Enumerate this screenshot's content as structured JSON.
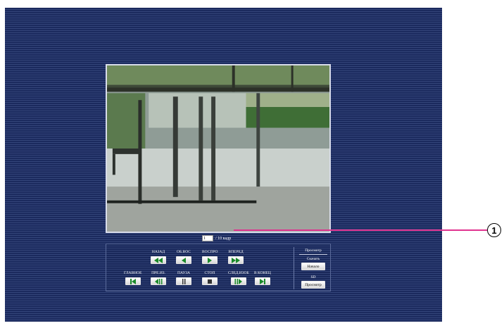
{
  "frame": {
    "current_value": "1",
    "total_text": "/ 10 кадр"
  },
  "controls": {
    "row1": [
      {
        "label": "НАЗАД",
        "icon": "fast-rewind-icon"
      },
      {
        "label": "ОБ.ВОС",
        "icon": "reverse-play-icon"
      },
      {
        "label": "ВОСПРО",
        "icon": "play-icon"
      },
      {
        "label": "ВПЕРЕД",
        "icon": "fast-forward-icon"
      }
    ],
    "row2": [
      {
        "label": "ГЛАВНОЕ",
        "icon": "skip-to-start-icon"
      },
      {
        "label": "ПРЕ.ИЗ.",
        "icon": "previous-frame-icon"
      },
      {
        "label": "ПАУЗА",
        "icon": "pause-icon"
      },
      {
        "label": "СТОП",
        "icon": "stop-icon"
      },
      {
        "label": "СЛЕД.ИЗОБ",
        "icon": "next-frame-icon"
      },
      {
        "label": "В КОНЕЦ",
        "icon": "skip-to-end-icon"
      }
    ]
  },
  "side_panel": {
    "title": "Просмотр",
    "download_label": "Скачать",
    "start_button": "Начало",
    "sd_label": "SD",
    "view_button": "Просмотр"
  },
  "callout": {
    "number": "1",
    "color": "#e0338f"
  },
  "colors": {
    "background": "#1b2a5e",
    "button_icon": "#1a8a2a"
  }
}
